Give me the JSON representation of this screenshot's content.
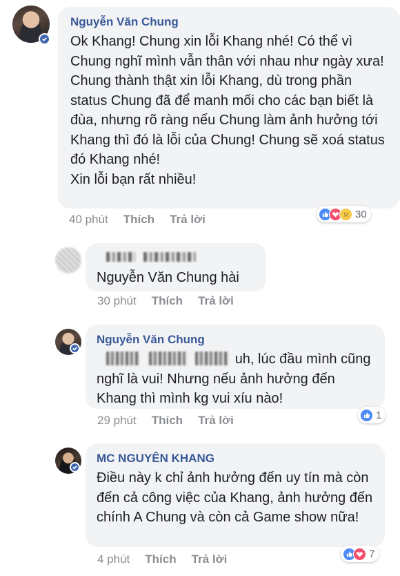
{
  "comments": [
    {
      "name": "Nguyễn Văn Chung",
      "text": "Ok Khang! Chung xin lỗi Khang nhé! Có thể vì Chung nghĩ mình vẫn thân với nhau như ngày xưa! Chung thành thật xin lỗi Khang, dù trong phần status Chung đã để manh mối cho các bạn biết là đùa, nhưng rõ ràng nếu Chung làm ảnh hưởng tới Khang thì đó là lỗi của Chung! Chung sẽ xoá status đó Khang nhé!",
      "text2": "Xin lỗi bạn rất nhiều!",
      "time": "40 phút",
      "like": "Thích",
      "reply": "Trả lời",
      "reaction_count": "30"
    },
    {
      "text": "Nguyễn Văn Chung hài",
      "time": "30 phút",
      "like": "Thích",
      "reply": "Trả lời"
    },
    {
      "name": "Nguyễn Văn Chung",
      "text_after_blur": "uh, lúc đầu mình cũng",
      "text": "nghĩ là vui! Nhưng nếu ảnh hưởng đến Khang thì mình kg vui xíu nào!",
      "time": "29 phút",
      "like": "Thích",
      "reply": "Trả lời",
      "reaction_count": "1"
    },
    {
      "name": "MC NGUYÊN KHANG",
      "text": "Điều này k chỉ ảnh hưởng đến uy tín mà còn đến cả công việc của Khang, ảnh hưởng đến chính A Chung và còn cả Game show nữa!",
      "time": "4 phút",
      "like": "Thích",
      "reply": "Trả lời",
      "reaction_count": "7"
    }
  ],
  "colors": {
    "bubble": "#f2f3f5",
    "name": "#385898",
    "meta": "#8a8d91",
    "like": "#4c8bf5",
    "love": "#f0506e",
    "sad": "#f7c948"
  }
}
